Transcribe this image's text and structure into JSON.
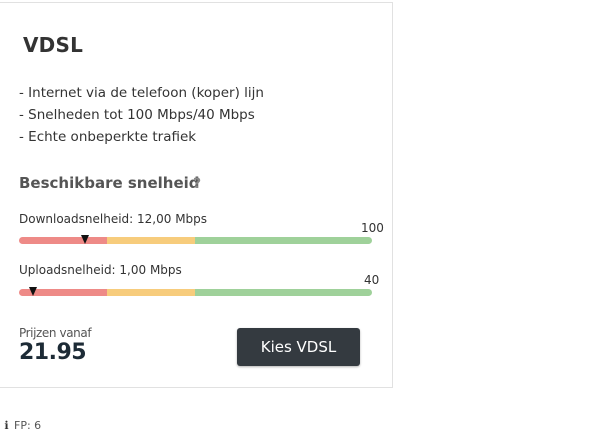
{
  "product": {
    "title": "VDSL",
    "features": [
      "- Internet via de telefoon (koper) lijn",
      "- Snelheden tot 100 Mbps/40 Mbps",
      "- Echte onbeperkte trafiek"
    ]
  },
  "speed": {
    "heading": "Beschikbare snelheid",
    "help_icon": "?",
    "download": {
      "label": "Downloadsnelheid: 12,00 Mbps",
      "value": 12.0,
      "max": 100,
      "max_label": "100"
    },
    "upload": {
      "label": "Uploadsnelheid: 1,00 Mbps",
      "value": 1.0,
      "max": 40,
      "max_label": "40"
    }
  },
  "price": {
    "label": "Prijzen vanaf",
    "value": "21.95"
  },
  "cta": {
    "label": "Kies VDSL"
  },
  "footer": {
    "icon": "info-icon",
    "text": "FP: 6"
  },
  "colors": {
    "bar_low": "#ee8a87",
    "bar_mid": "#f7cc7c",
    "bar_high": "#9fd19a",
    "button_bg": "#343a40"
  }
}
